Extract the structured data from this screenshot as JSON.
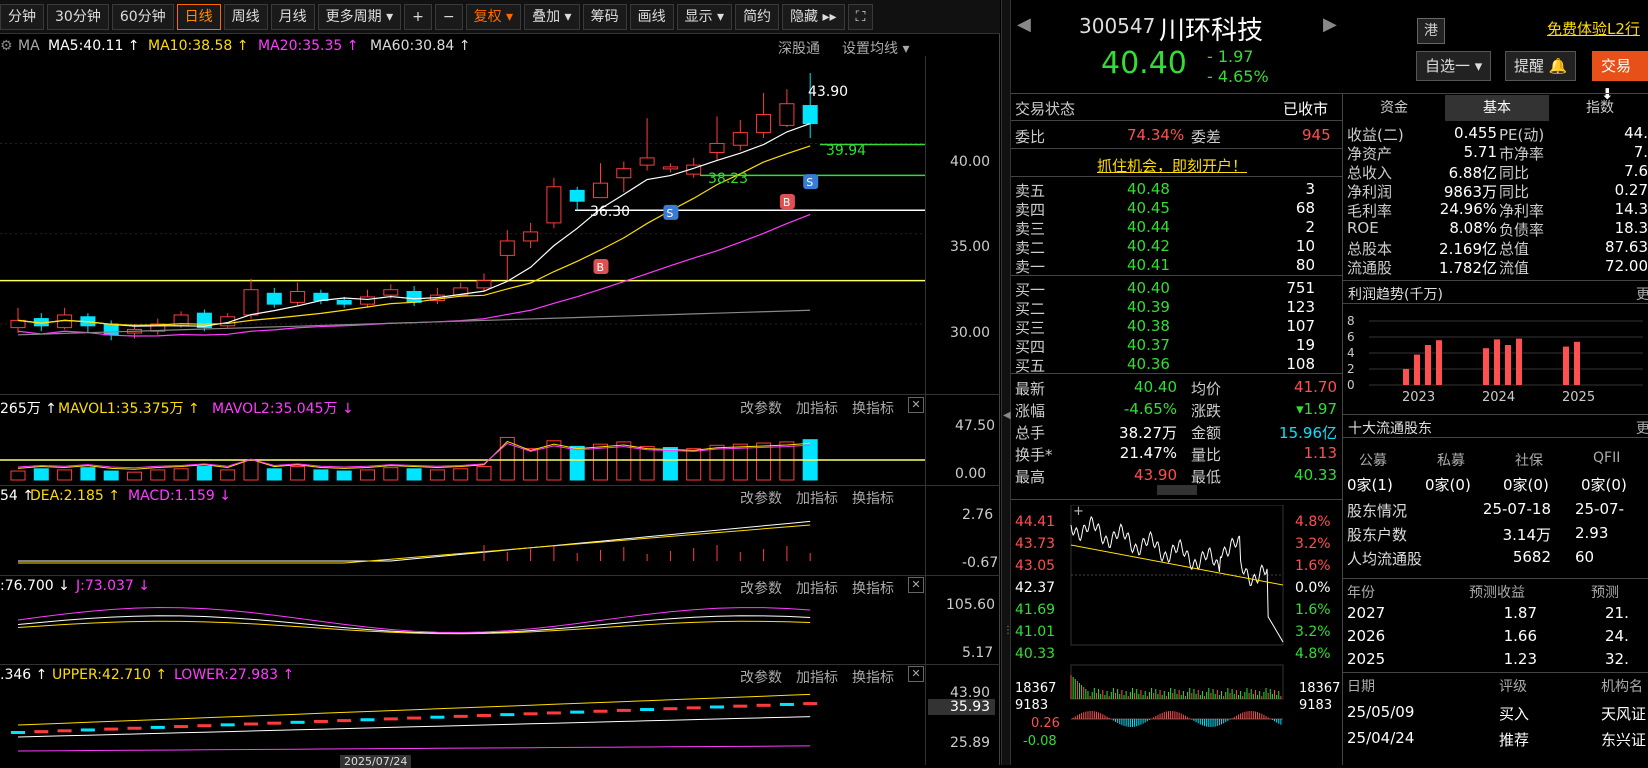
{
  "toolbar": {
    "items": [
      "分钟",
      "30分钟",
      "60分钟",
      "日线",
      "周线",
      "月线",
      "更多周期 ▾",
      "+",
      "−",
      "复权 ▾",
      "叠加 ▾",
      "筹码",
      "画线",
      "显示 ▾",
      "简约",
      "隐藏 ▸▸",
      "⛶"
    ],
    "active_index": 3
  },
  "ma_legend": {
    "ma": "MA",
    "ma5": "MA5:40.11 ↑",
    "ma10": "MA10:38.58 ↑",
    "ma20": "MA20:35.35 ↑",
    "ma60": "MA60:30.84 ↑",
    "shenjian": "深股通",
    "setma": "设置均线 ▾"
  },
  "price_axis": [
    "40.00",
    "35.00",
    "30.00"
  ],
  "price_annotations": {
    "high": "43.90",
    "l1": "39.94",
    "l2": "38.23",
    "l3": "36.30"
  },
  "vol_legend": {
    "a": "265万 ↑",
    "b": "MAVOL1:35.375万 ↑",
    "c": "MAVOL2:35.045万 ↓"
  },
  "vol_axis": [
    "47.50",
    "0.00"
  ],
  "macd_legend": {
    "a": "54 ↑",
    "b": "DEA:2.185 ↑",
    "c": "MACD:1.159 ↓"
  },
  "macd_axis": [
    "2.76",
    "-0.67"
  ],
  "kdj_legend": {
    "a": ":76.700 ↓",
    "b": "J:73.037 ↓"
  },
  "kdj_axis": [
    "105.60",
    "5.17"
  ],
  "boll_legend": {
    "a": ".346 ↑",
    "b": "UPPER:42.710 ↑",
    "c": "LOWER:27.983 ↑"
  },
  "boll_axis": [
    "43.90",
    "35.93",
    "25.89"
  ],
  "panel_actions": [
    "改参数",
    "加指标",
    "换指标"
  ],
  "header": {
    "code": "300547",
    "name": "川环科技",
    "price": "40.40",
    "change": "- 1.97",
    "change_pct": "- 4.65%",
    "hk": "港",
    "trial": "免费体验L2行",
    "watch": "自选一 ▾",
    "remind": "提醒 🔔",
    "trade": "交易 ⬇"
  },
  "status": {
    "label": "交易状态",
    "value": "已收市"
  },
  "weibi": {
    "label": "委比",
    "value": "74.34%",
    "label2": "委差",
    "value2": "945"
  },
  "promo": "抓住机会，即刻开户！",
  "sells": [
    {
      "label": "卖五",
      "price": "40.48",
      "vol": "3"
    },
    {
      "label": "卖四",
      "price": "40.45",
      "vol": "68"
    },
    {
      "label": "卖三",
      "price": "40.44",
      "vol": "2"
    },
    {
      "label": "卖二",
      "price": "40.42",
      "vol": "10"
    },
    {
      "label": "卖一",
      "price": "40.41",
      "vol": "80"
    }
  ],
  "buys": [
    {
      "label": "买一",
      "price": "40.40",
      "vol": "751"
    },
    {
      "label": "买二",
      "price": "40.39",
      "vol": "123"
    },
    {
      "label": "买三",
      "price": "40.38",
      "vol": "107"
    },
    {
      "label": "买四",
      "price": "40.37",
      "vol": "19"
    },
    {
      "label": "买五",
      "price": "40.36",
      "vol": "108"
    }
  ],
  "stats": [
    {
      "l1": "最新",
      "v1": "40.40",
      "l2": "均价",
      "v2": "41.70"
    },
    {
      "l1": "涨幅",
      "v1": "-4.65%",
      "l2": "涨跌",
      "v2": "▾1.97"
    },
    {
      "l1": "总手",
      "v1": "38.27万",
      "l2": "金额",
      "v2": "15.96亿"
    },
    {
      "l1": "换手*",
      "v1": "21.47%",
      "l2": "量比",
      "v2": "1.13"
    },
    {
      "l1": "最高",
      "v1": "43.90",
      "l2": "最低",
      "v2": "40.33"
    }
  ],
  "intraday_axis_left": [
    "44.41",
    "43.73",
    "43.05",
    "42.37",
    "41.69",
    "41.01",
    "40.33"
  ],
  "intraday_axis_right": [
    "4.8%",
    "3.2%",
    "1.6%",
    "0.0%",
    "1.6%",
    "3.2%",
    "4.8%"
  ],
  "intraday_vol_axis": [
    "18367",
    "9183"
  ],
  "intraday_macd_axis": [
    "0.26",
    "-0.08"
  ],
  "tabs": [
    "资金",
    "基本",
    "指数"
  ],
  "fundamentals": [
    {
      "l1": "收益(二)",
      "v1": "0.455",
      "l2": "PE(动)",
      "v2": "44."
    },
    {
      "l1": "净资产",
      "v1": "5.71",
      "l2": "市净率",
      "v2": "7."
    },
    {
      "l1": "总收入",
      "v1": "6.88亿",
      "l2": "同比",
      "v2": "7.6"
    },
    {
      "l1": "净利润",
      "v1": "9863万",
      "l2": "同比",
      "v2": "0.27"
    },
    {
      "l1": "毛利率",
      "v1": "24.96%",
      "l2": "净利率",
      "v2": "14.3"
    },
    {
      "l1": "ROE",
      "v1": "8.08%",
      "l2": "负债率",
      "v2": "18.3"
    },
    {
      "l1": "总股本",
      "v1": "2.169亿",
      "l2": "总值",
      "v2": "87.63"
    },
    {
      "l1": "流通股",
      "v1": "1.782亿",
      "l2": "流值",
      "v2": "72.00"
    }
  ],
  "profit_trend": {
    "title": "利润趋势(千万)",
    "more": "更",
    "y_ticks": [
      "8",
      "6",
      "4",
      "2",
      "0"
    ],
    "years": [
      "2023",
      "2024",
      "2025"
    ]
  },
  "chart_data": {
    "type": "bar",
    "title": "利润趋势(千万)",
    "categories": [
      "2023Q1",
      "2023Q2",
      "2023Q3",
      "2023Q4",
      "2024Q1",
      "2024Q2",
      "2024Q3",
      "2024Q4",
      "2025Q1",
      "2025Q2"
    ],
    "values": [
      2.0,
      3.8,
      5.0,
      5.6,
      4.6,
      5.7,
      5.0,
      5.8,
      4.8,
      5.4
    ],
    "ylim": [
      0,
      8
    ]
  },
  "holders": {
    "title": "十大流通股东",
    "more": "更",
    "headers": [
      "公募",
      "私募",
      "社保",
      "QFII"
    ],
    "values": [
      "0家(1)",
      "0家(0)",
      "0家(0)",
      "0家(0)"
    ]
  },
  "holder_info": [
    {
      "label": "股东情况",
      "v1": "25-07-18",
      "v2": "25-07-"
    },
    {
      "label": "股东户数",
      "v1": "3.14万",
      "v2": "2.93"
    },
    {
      "label": "人均流通股",
      "v1": "5682",
      "v2": "60"
    }
  ],
  "forecast": {
    "headers": [
      "年份",
      "预测收益",
      "预测"
    ],
    "rows": [
      {
        "y": "2027",
        "e": "1.87",
        "p": "21."
      },
      {
        "y": "2026",
        "e": "1.66",
        "p": "24."
      },
      {
        "y": "2025",
        "e": "1.23",
        "p": "32."
      }
    ]
  },
  "ratings": {
    "headers": [
      "日期",
      "评级",
      "机构名"
    ],
    "rows": [
      {
        "d": "25/05/09",
        "r": "买入",
        "o": "天风证"
      },
      {
        "d": "25/04/24",
        "r": "推荐",
        "o": "东兴证"
      }
    ]
  },
  "xaxis_date": "2025/07/24"
}
